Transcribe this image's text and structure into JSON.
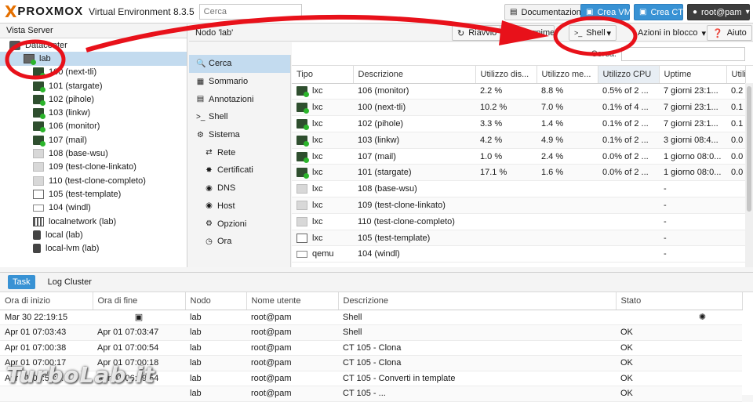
{
  "app": {
    "logo_x": "X",
    "logo_text": "PROXMOX",
    "product": "Virtual Environment 8.3.5",
    "search_placeholder": "Cerca"
  },
  "topbar": {
    "docs": "Documentazione",
    "create_vm": "Crea VM",
    "create_ct": "Crea CT",
    "user": "root@pam"
  },
  "left": {
    "header": "Vista Server",
    "datacenter": "Datacenter",
    "node": "lab",
    "items": [
      {
        "label": "100 (next-tli)",
        "type": "ct-on"
      },
      {
        "label": "101 (stargate)",
        "type": "ct-on"
      },
      {
        "label": "102 (pihole)",
        "type": "ct-on"
      },
      {
        "label": "103 (linkw)",
        "type": "ct-on"
      },
      {
        "label": "106 (monitor)",
        "type": "ct-on"
      },
      {
        "label": "107 (mail)",
        "type": "ct-on"
      },
      {
        "label": "108 (base-wsu)",
        "type": "ct-off"
      },
      {
        "label": "109 (test-clone-linkato)",
        "type": "ct-off"
      },
      {
        "label": "110 (test-clone-completo)",
        "type": "ct-off"
      },
      {
        "label": "105 (test-template)",
        "type": "tpl"
      },
      {
        "label": "104 (windl)",
        "type": "vm"
      },
      {
        "label": "localnetwork (lab)",
        "type": "net"
      },
      {
        "label": "local (lab)",
        "type": "disk"
      },
      {
        "label": "local-lvm (lab)",
        "type": "disk"
      }
    ]
  },
  "node_header": {
    "title": "Nodo 'lab'",
    "reboot": "Riavvio",
    "shutdown": "Spegnimento",
    "shell": "Shell",
    "bulk": "Azioni in blocco",
    "help": "Aiuto"
  },
  "nav": {
    "items": [
      {
        "label": "Cerca",
        "icon": "search-icon",
        "sel": true,
        "sub": false
      },
      {
        "label": "Sommario",
        "icon": "summary-icon",
        "sel": false,
        "sub": false
      },
      {
        "label": "Annotazioni",
        "icon": "notes-icon",
        "sel": false,
        "sub": false
      },
      {
        "label": "Shell",
        "icon": "terminal-icon",
        "sel": false,
        "sub": false
      },
      {
        "label": "Sistema",
        "icon": "gear-icon",
        "sel": false,
        "sub": false
      },
      {
        "label": "Rete",
        "icon": "network-icon",
        "sel": false,
        "sub": true
      },
      {
        "label": "Certificati",
        "icon": "certificate-icon",
        "sel": false,
        "sub": true
      },
      {
        "label": "DNS",
        "icon": "globe-icon",
        "sel": false,
        "sub": true
      },
      {
        "label": "Host",
        "icon": "globe-icon",
        "sel": false,
        "sub": true
      },
      {
        "label": "Opzioni",
        "icon": "gear-icon",
        "sel": false,
        "sub": true
      },
      {
        "label": "Ora",
        "icon": "clock-icon",
        "sel": false,
        "sub": true
      }
    ]
  },
  "grid": {
    "search_label": "Cerca:",
    "columns": [
      "Tipo",
      "Descrizione",
      "Utilizzo dis...",
      "Utilizzo me...",
      "Utilizzo CPU",
      "Uptime",
      "Utilizz"
    ],
    "rows": [
      {
        "tipo": "lxc",
        "desc": "106 (monitor)",
        "disk": "2.2 %",
        "mem": "8.8 %",
        "cpu": "0.5% of 2 ...",
        "uptime": "7 giorni 23:1...",
        "last": "0.2",
        "icon": "ct-on"
      },
      {
        "tipo": "lxc",
        "desc": "100 (next-tli)",
        "disk": "10.2 %",
        "mem": "7.0 %",
        "cpu": "0.1% of 4 ...",
        "uptime": "7 giorni 23:1...",
        "last": "0.1",
        "icon": "ct-on"
      },
      {
        "tipo": "lxc",
        "desc": "102 (pihole)",
        "disk": "3.3 %",
        "mem": "1.4 %",
        "cpu": "0.1% of 2 ...",
        "uptime": "7 giorni 23:1...",
        "last": "0.1",
        "icon": "ct-on"
      },
      {
        "tipo": "lxc",
        "desc": "103 (linkw)",
        "disk": "4.2 %",
        "mem": "4.9 %",
        "cpu": "0.1% of 2 ...",
        "uptime": "3 giorni 08:4...",
        "last": "0.0",
        "icon": "ct-on"
      },
      {
        "tipo": "lxc",
        "desc": "107 (mail)",
        "disk": "1.0 %",
        "mem": "2.4 %",
        "cpu": "0.0% of 2 ...",
        "uptime": "1 giorno 08:0...",
        "last": "0.0",
        "icon": "ct-on"
      },
      {
        "tipo": "lxc",
        "desc": "101 (stargate)",
        "disk": "17.1 %",
        "mem": "1.6 %",
        "cpu": "0.0% of 2 ...",
        "uptime": "1 giorno 08:0...",
        "last": "0.0",
        "icon": "ct-on"
      },
      {
        "tipo": "lxc",
        "desc": "108 (base-wsu)",
        "disk": "",
        "mem": "",
        "cpu": "",
        "uptime": "-",
        "last": "",
        "icon": "ct-off"
      },
      {
        "tipo": "lxc",
        "desc": "109 (test-clone-linkato)",
        "disk": "",
        "mem": "",
        "cpu": "",
        "uptime": "-",
        "last": "",
        "icon": "ct-off"
      },
      {
        "tipo": "lxc",
        "desc": "110 (test-clone-completo)",
        "disk": "",
        "mem": "",
        "cpu": "",
        "uptime": "-",
        "last": "",
        "icon": "ct-off"
      },
      {
        "tipo": "lxc",
        "desc": "105 (test-template)",
        "disk": "",
        "mem": "",
        "cpu": "",
        "uptime": "-",
        "last": "",
        "icon": "tpl"
      },
      {
        "tipo": "qemu",
        "desc": "104 (windl)",
        "disk": "",
        "mem": "",
        "cpu": "",
        "uptime": "-",
        "last": "",
        "icon": "vm"
      }
    ]
  },
  "tasks": {
    "tab_task": "Task",
    "tab_log": "Log Cluster",
    "columns": [
      "Ora di inizio",
      "Ora di fine",
      "Nodo",
      "Nome utente",
      "Descrizione",
      "Stato"
    ],
    "rows": [
      {
        "start": "Mar 30 22:19:15",
        "end": "",
        "node": "lab",
        "user": "root@pam",
        "desc": "Shell",
        "status": "",
        "running": true
      },
      {
        "start": "Apr 01 07:03:43",
        "end": "Apr 01 07:03:47",
        "node": "lab",
        "user": "root@pam",
        "desc": "Shell",
        "status": "OK",
        "running": false
      },
      {
        "start": "Apr 01 07:00:38",
        "end": "Apr 01 07:00:54",
        "node": "lab",
        "user": "root@pam",
        "desc": "CT 105 - Clona",
        "status": "OK",
        "running": false
      },
      {
        "start": "Apr 01 07:00:17",
        "end": "Apr 01 07:00:18",
        "node": "lab",
        "user": "root@pam",
        "desc": "CT 105 - Clona",
        "status": "OK",
        "running": false
      },
      {
        "start": "Apr 01 06:59:...",
        "end": "Apr 01 06:59:54",
        "node": "lab",
        "user": "root@pam",
        "desc": "CT 105 - Converti in template",
        "status": "OK",
        "running": false
      },
      {
        "start": "",
        "end": "",
        "node": "lab",
        "user": "root@pam",
        "desc": "CT 105 - ...",
        "status": "OK",
        "running": false
      }
    ]
  },
  "watermark": "TurboLab.it",
  "colors": {
    "accent": "#3892d4",
    "brand": "#e57000",
    "annotation": "#e8111a"
  }
}
